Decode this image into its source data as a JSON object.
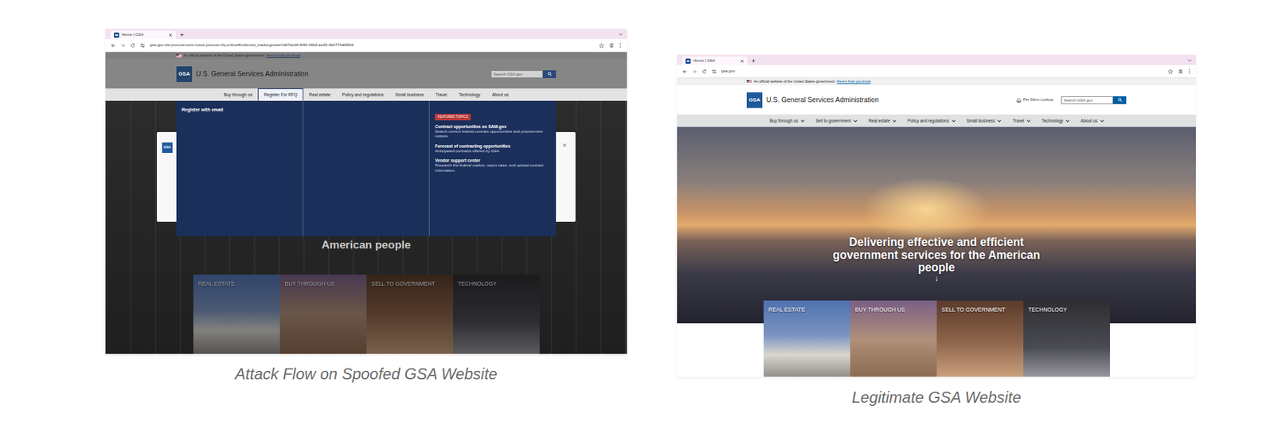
{
  "screenshots": [
    {
      "caption": "Attack Flow on Spoofed GSA Website",
      "dimmed": true,
      "browser": {
        "tab_title": "Home | GSA",
        "url": "gsa-gov-dst-procurement-notice.procure-rfq.online/#mobmret_trackingnotier=d07dcd6-9f40-44b3-ae25-4b0774d0f0b6"
      },
      "banner": {
        "text": "An official website of the United States government",
        "link": "Here's how you know"
      },
      "site": {
        "logo": "GSA",
        "title": "U.S. General Services Administration",
        "search_placeholder": "Search GSA.gov",
        "nav_chevrons": false,
        "nav": [
          {
            "label": "Buy through us",
            "selected": false
          },
          {
            "label": "Register For RFQ",
            "selected": true
          },
          {
            "label": "Real estate",
            "selected": false
          },
          {
            "label": "Policy and regulations",
            "selected": false
          },
          {
            "label": "Small business",
            "selected": false
          },
          {
            "label": "Travel",
            "selected": false
          },
          {
            "label": "Technology",
            "selected": false
          },
          {
            "label": "About us",
            "selected": false
          }
        ]
      },
      "modal": {
        "logo": "GSA",
        "close": "×"
      },
      "menu": {
        "heading": "Register with email",
        "featured_label": "FEATURED TOPICS",
        "links": [
          {
            "title": "Contract opportunities on SAM.gov",
            "desc": "Search current federal contract opportunities and procurement notices."
          },
          {
            "title": "Forecast of contracting opportunities",
            "desc": "Anticipated contracts offered by GSA."
          },
          {
            "title": "Vendor support center",
            "desc": "Research the federal market, report sales, and upload contract information."
          }
        ]
      },
      "hero": {
        "lines": [
          "American people"
        ]
      },
      "tiles": [
        "REAL ESTATE",
        "BUY THROUGH US",
        "SELL TO GOVERNMENT",
        "TECHNOLOGY"
      ]
    },
    {
      "caption": "Legitimate GSA Website",
      "dimmed": false,
      "browser": {
        "tab_title": "Home | GSA",
        "url": "gsa.gov"
      },
      "banner": {
        "text": "An official website of the United States government",
        "link": "Here's how you know"
      },
      "site": {
        "logo": "GSA",
        "title": "U.S. General Services Administration",
        "utility_link": "Per Diem Lookup",
        "search_placeholder": "Search GSA.gov",
        "nav_chevrons": true,
        "nav": [
          {
            "label": "Buy through us",
            "selected": false
          },
          {
            "label": "Sell to government",
            "selected": false
          },
          {
            "label": "Real estate",
            "selected": false
          },
          {
            "label": "Policy and regulations",
            "selected": false
          },
          {
            "label": "Small business",
            "selected": false
          },
          {
            "label": "Travel",
            "selected": false
          },
          {
            "label": "Technology",
            "selected": false
          },
          {
            "label": "About us",
            "selected": false
          }
        ]
      },
      "hero": {
        "lines": [
          "Delivering effective and efficient",
          "government services for the American",
          "people"
        ],
        "arrow": "↓"
      },
      "tiles": [
        "REAL ESTATE",
        "BUY THROUGH US",
        "SELL TO GOVERNMENT",
        "TECHNOLOGY"
      ]
    }
  ]
}
